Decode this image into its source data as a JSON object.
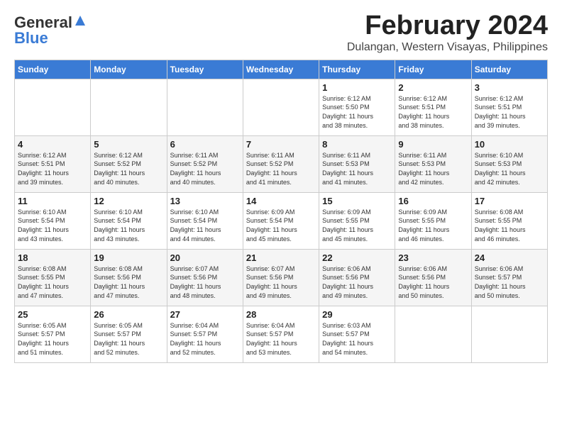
{
  "header": {
    "logo_general": "General",
    "logo_blue": "Blue",
    "month_title": "February 2024",
    "location": "Dulangan, Western Visayas, Philippines"
  },
  "days_of_week": [
    "Sunday",
    "Monday",
    "Tuesday",
    "Wednesday",
    "Thursday",
    "Friday",
    "Saturday"
  ],
  "weeks": [
    [
      {
        "day": "",
        "info": ""
      },
      {
        "day": "",
        "info": ""
      },
      {
        "day": "",
        "info": ""
      },
      {
        "day": "",
        "info": ""
      },
      {
        "day": "1",
        "info": "Sunrise: 6:12 AM\nSunset: 5:50 PM\nDaylight: 11 hours\nand 38 minutes."
      },
      {
        "day": "2",
        "info": "Sunrise: 6:12 AM\nSunset: 5:51 PM\nDaylight: 11 hours\nand 38 minutes."
      },
      {
        "day": "3",
        "info": "Sunrise: 6:12 AM\nSunset: 5:51 PM\nDaylight: 11 hours\nand 39 minutes."
      }
    ],
    [
      {
        "day": "4",
        "info": "Sunrise: 6:12 AM\nSunset: 5:51 PM\nDaylight: 11 hours\nand 39 minutes."
      },
      {
        "day": "5",
        "info": "Sunrise: 6:12 AM\nSunset: 5:52 PM\nDaylight: 11 hours\nand 40 minutes."
      },
      {
        "day": "6",
        "info": "Sunrise: 6:11 AM\nSunset: 5:52 PM\nDaylight: 11 hours\nand 40 minutes."
      },
      {
        "day": "7",
        "info": "Sunrise: 6:11 AM\nSunset: 5:52 PM\nDaylight: 11 hours\nand 41 minutes."
      },
      {
        "day": "8",
        "info": "Sunrise: 6:11 AM\nSunset: 5:53 PM\nDaylight: 11 hours\nand 41 minutes."
      },
      {
        "day": "9",
        "info": "Sunrise: 6:11 AM\nSunset: 5:53 PM\nDaylight: 11 hours\nand 42 minutes."
      },
      {
        "day": "10",
        "info": "Sunrise: 6:10 AM\nSunset: 5:53 PM\nDaylight: 11 hours\nand 42 minutes."
      }
    ],
    [
      {
        "day": "11",
        "info": "Sunrise: 6:10 AM\nSunset: 5:54 PM\nDaylight: 11 hours\nand 43 minutes."
      },
      {
        "day": "12",
        "info": "Sunrise: 6:10 AM\nSunset: 5:54 PM\nDaylight: 11 hours\nand 43 minutes."
      },
      {
        "day": "13",
        "info": "Sunrise: 6:10 AM\nSunset: 5:54 PM\nDaylight: 11 hours\nand 44 minutes."
      },
      {
        "day": "14",
        "info": "Sunrise: 6:09 AM\nSunset: 5:54 PM\nDaylight: 11 hours\nand 45 minutes."
      },
      {
        "day": "15",
        "info": "Sunrise: 6:09 AM\nSunset: 5:55 PM\nDaylight: 11 hours\nand 45 minutes."
      },
      {
        "day": "16",
        "info": "Sunrise: 6:09 AM\nSunset: 5:55 PM\nDaylight: 11 hours\nand 46 minutes."
      },
      {
        "day": "17",
        "info": "Sunrise: 6:08 AM\nSunset: 5:55 PM\nDaylight: 11 hours\nand 46 minutes."
      }
    ],
    [
      {
        "day": "18",
        "info": "Sunrise: 6:08 AM\nSunset: 5:55 PM\nDaylight: 11 hours\nand 47 minutes."
      },
      {
        "day": "19",
        "info": "Sunrise: 6:08 AM\nSunset: 5:56 PM\nDaylight: 11 hours\nand 47 minutes."
      },
      {
        "day": "20",
        "info": "Sunrise: 6:07 AM\nSunset: 5:56 PM\nDaylight: 11 hours\nand 48 minutes."
      },
      {
        "day": "21",
        "info": "Sunrise: 6:07 AM\nSunset: 5:56 PM\nDaylight: 11 hours\nand 49 minutes."
      },
      {
        "day": "22",
        "info": "Sunrise: 6:06 AM\nSunset: 5:56 PM\nDaylight: 11 hours\nand 49 minutes."
      },
      {
        "day": "23",
        "info": "Sunrise: 6:06 AM\nSunset: 5:56 PM\nDaylight: 11 hours\nand 50 minutes."
      },
      {
        "day": "24",
        "info": "Sunrise: 6:06 AM\nSunset: 5:57 PM\nDaylight: 11 hours\nand 50 minutes."
      }
    ],
    [
      {
        "day": "25",
        "info": "Sunrise: 6:05 AM\nSunset: 5:57 PM\nDaylight: 11 hours\nand 51 minutes."
      },
      {
        "day": "26",
        "info": "Sunrise: 6:05 AM\nSunset: 5:57 PM\nDaylight: 11 hours\nand 52 minutes."
      },
      {
        "day": "27",
        "info": "Sunrise: 6:04 AM\nSunset: 5:57 PM\nDaylight: 11 hours\nand 52 minutes."
      },
      {
        "day": "28",
        "info": "Sunrise: 6:04 AM\nSunset: 5:57 PM\nDaylight: 11 hours\nand 53 minutes."
      },
      {
        "day": "29",
        "info": "Sunrise: 6:03 AM\nSunset: 5:57 PM\nDaylight: 11 hours\nand 54 minutes."
      },
      {
        "day": "",
        "info": ""
      },
      {
        "day": "",
        "info": ""
      }
    ]
  ]
}
